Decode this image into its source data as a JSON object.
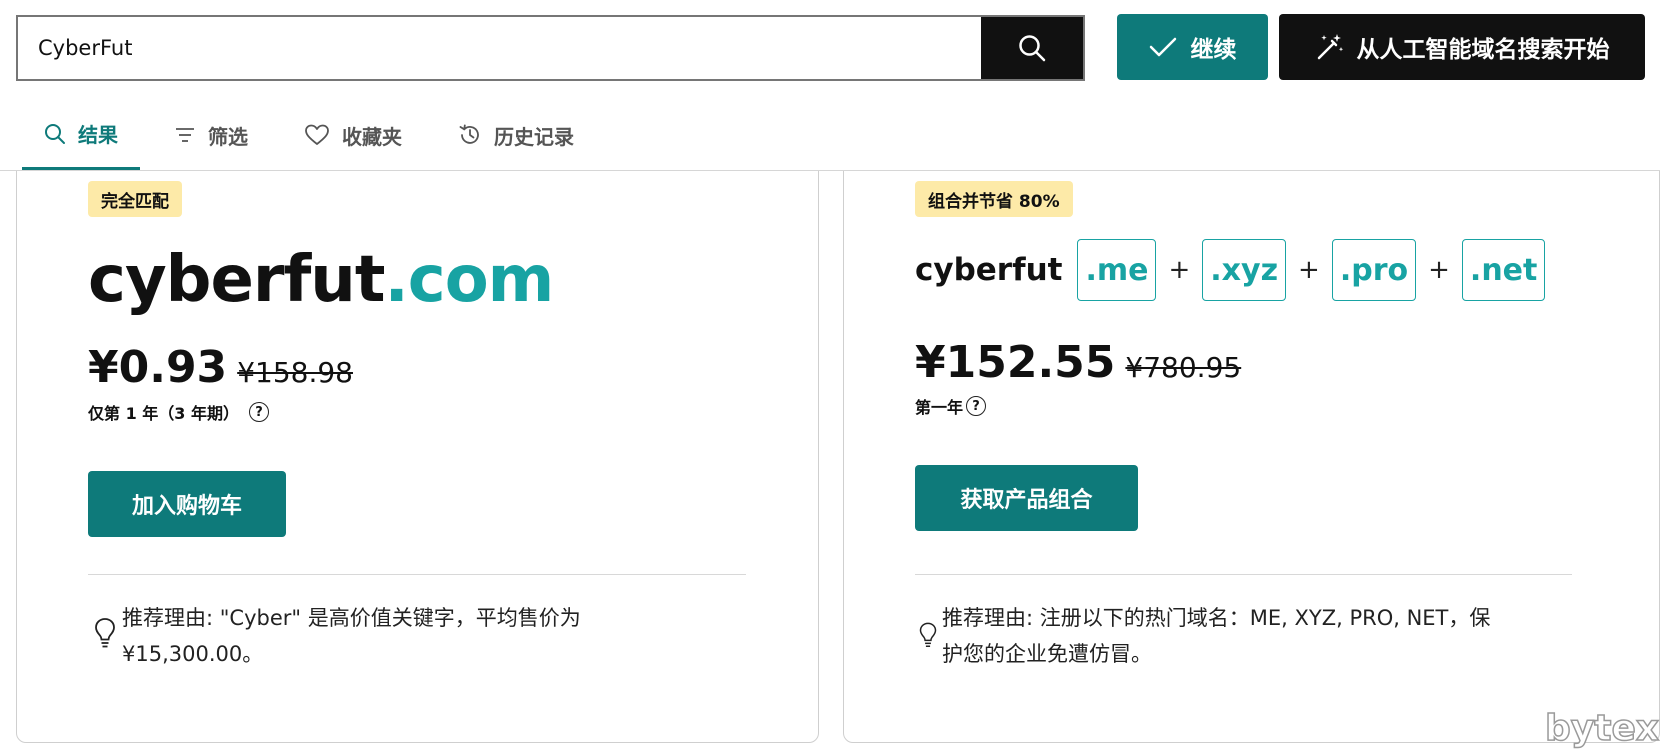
{
  "header": {
    "search_value": "CyberFut",
    "continue_label": "继续",
    "ai_search_label": "从人工智能域名搜索开始"
  },
  "tabs": [
    {
      "label": "结果"
    },
    {
      "label": "筛选"
    },
    {
      "label": "收藏夹"
    },
    {
      "label": "历史记录"
    }
  ],
  "exact_match": {
    "badge": "完全匹配",
    "domain_name": "cyberfut",
    "tld": ".com",
    "price": "¥0.93",
    "old_price": "¥158.98",
    "term": "仅第 1 年（3 年期）",
    "button": "加入购物车",
    "reason_line1": "推荐理由: \"Cyber\" 是高价值关键字，平均售价为",
    "reason_line2": "¥15,300.00。"
  },
  "bundle": {
    "badge": "组合并节省 80%",
    "domain_name": "cyberfut",
    "tlds": [
      ".me",
      ".xyz",
      ".pro",
      ".net"
    ],
    "plus": "+",
    "price": "¥152.55",
    "old_price": "¥780.95",
    "term": "第一年",
    "button": "获取产品组合",
    "reason_line1": "推荐理由: 注册以下的热门域名：ME, XYZ, PRO, NET，保",
    "reason_line2": "护您的企业免遭仿冒。"
  },
  "watermark": "bytex",
  "colors": {
    "teal": "#0e7a7a",
    "tld_teal": "#18a3a3",
    "badge_bg": "#fdeaa8",
    "dark": "#111111"
  }
}
